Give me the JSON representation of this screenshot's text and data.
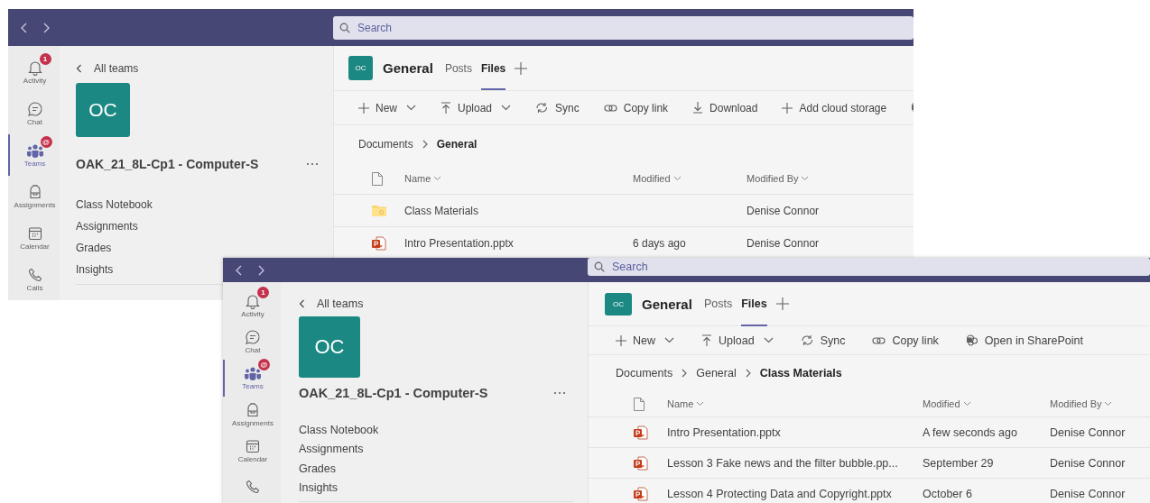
{
  "windows": [
    {
      "search": {
        "placeholder": "Search"
      },
      "rail": [
        {
          "kind": "activity",
          "label": "Activity",
          "badge": "1",
          "selected": false
        },
        {
          "kind": "chat",
          "label": "Chat",
          "selected": false
        },
        {
          "kind": "teams",
          "label": "Teams",
          "badge": "@",
          "selected": true
        },
        {
          "kind": "assignments",
          "label": "Assignments",
          "selected": false
        },
        {
          "kind": "calendar",
          "label": "Calendar",
          "selected": false
        },
        {
          "kind": "calls",
          "label": "Calls",
          "selected": false
        }
      ],
      "panel": {
        "back_link": "All teams",
        "team_avatar": "OC",
        "team_name": "OAK_21_8L-Cp1 - Computer-S",
        "nav": [
          "Class Notebook",
          "Assignments",
          "Grades",
          "Insights"
        ]
      },
      "channel": {
        "avatar": "OC",
        "name": "General",
        "tabs": [
          {
            "label": "Posts",
            "selected": false
          },
          {
            "label": "Files",
            "selected": true
          }
        ]
      },
      "toolbar": [
        {
          "kind": "new",
          "label": "New",
          "dropdown": true
        },
        {
          "kind": "upload",
          "label": "Upload",
          "dropdown": true
        },
        {
          "kind": "sync",
          "label": "Sync",
          "dropdown": false
        },
        {
          "kind": "link",
          "label": "Copy link",
          "dropdown": false
        },
        {
          "kind": "download",
          "label": "Download",
          "dropdown": false
        },
        {
          "kind": "add",
          "label": "Add cloud storage",
          "dropdown": false
        },
        {
          "kind": "sharepoint",
          "dropdown": false
        }
      ],
      "breadcrumb": [
        "Documents",
        "General"
      ],
      "columns": [
        "Name",
        "Modified",
        "Modified By"
      ],
      "rows": [
        {
          "kind": "folder",
          "name": "Class Materials",
          "modified_by": "Denise Connor"
        },
        {
          "kind": "pptx",
          "name": "Intro Presentation.pptx",
          "modified": "6 days ago",
          "modified_by": "Denise Connor"
        }
      ]
    },
    {
      "search": {
        "placeholder": "Search"
      },
      "rail": [
        {
          "kind": "activity",
          "label": "Activity",
          "badge": "1",
          "selected": false
        },
        {
          "kind": "chat",
          "label": "Chat",
          "selected": false
        },
        {
          "kind": "teams",
          "label": "Teams",
          "badge": "@",
          "selected": true
        },
        {
          "kind": "assignments",
          "label": "Assignments",
          "selected": false
        },
        {
          "kind": "calendar",
          "label": "Calendar",
          "selected": false
        },
        {
          "kind": "calls",
          "selected": false
        }
      ],
      "panel": {
        "back_link": "All teams",
        "team_avatar": "OC",
        "team_name": "OAK_21_8L-Cp1 - Computer-S",
        "nav": [
          "Class Notebook",
          "Assignments",
          "Grades",
          "Insights"
        ]
      },
      "channel": {
        "avatar": "OC",
        "name": "General",
        "tabs": [
          {
            "label": "Posts",
            "selected": false
          },
          {
            "label": "Files",
            "selected": true
          }
        ]
      },
      "toolbar": [
        {
          "kind": "new",
          "label": "New",
          "dropdown": true
        },
        {
          "kind": "upload",
          "label": "Upload",
          "dropdown": true
        },
        {
          "kind": "sync",
          "label": "Sync",
          "dropdown": false
        },
        {
          "kind": "link",
          "label": "Copy link",
          "dropdown": false
        },
        {
          "kind": "sharepoint",
          "label": "Open in SharePoint",
          "dropdown": false
        }
      ],
      "breadcrumb": [
        "Documents",
        "General",
        "Class Materials"
      ],
      "columns": [
        "Name",
        "Modified",
        "Modified By"
      ],
      "rows": [
        {
          "kind": "pptx",
          "name": "Intro Presentation.pptx",
          "modified": "A few seconds ago",
          "modified_by": "Denise Connor"
        },
        {
          "kind": "pptx",
          "name": "Lesson 3 Fake news and the filter bubble.pp...",
          "modified": "September 29",
          "modified_by": "Denise Connor"
        },
        {
          "kind": "pptx",
          "name": "Lesson 4 Protecting Data and Copyright.pptx",
          "modified": "October 6",
          "modified_by": "Denise Connor"
        }
      ]
    }
  ]
}
